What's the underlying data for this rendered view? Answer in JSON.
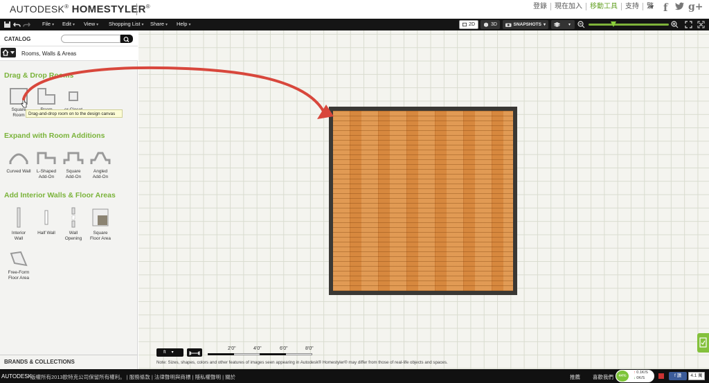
{
  "brand": {
    "prefix": "AUTODESK",
    "mark": "®",
    "name": "HOMESTYLER",
    "tm": "®"
  },
  "top_links": [
    "登錄",
    "現在加入",
    "移動工具",
    "支持",
    "繁"
  ],
  "toolbar": {
    "menus": [
      "File",
      "Edit",
      "View",
      "Shopping List",
      "Share",
      "Help"
    ],
    "view_2d": "2D",
    "view_3d": "3D",
    "snapshots": "SNAPSHOTS"
  },
  "panel": {
    "catalog_label": "CATALOG",
    "search_placeholder": "",
    "breadcrumb": "Rooms, Walls & Areas",
    "help_glyph": "?",
    "sections": [
      {
        "title": "Drag & Drop Rooms"
      },
      {
        "title": "Expand with Room Additions"
      },
      {
        "title": "Add Interior Walls & Floor Areas"
      }
    ],
    "drag_items": [
      {
        "label_1": "Square",
        "label_2": "Room"
      },
      {
        "label_1": "",
        "label_2": "Room"
      },
      {
        "label_1": "",
        "label_2": "or Closet"
      }
    ],
    "tooltip": "Drag-and-drop room on to the design canvas",
    "additions": [
      {
        "label_1": "Curved Wall",
        "label_2": ""
      },
      {
        "label_1": "L-Shaped",
        "label_2": "Add-On"
      },
      {
        "label_1": "Square",
        "label_2": "Add-On"
      },
      {
        "label_1": "Angled",
        "label_2": "Add-On"
      }
    ],
    "walls": [
      {
        "label_1": "Interior",
        "label_2": "Wall"
      },
      {
        "label_1": "Half Wall",
        "label_2": ""
      },
      {
        "label_1": "Wall",
        "label_2": "Opening"
      },
      {
        "label_1": "Square",
        "label_2": "Floor Area"
      },
      {
        "label_1": "Free-Form",
        "label_2": "Floor Area"
      }
    ],
    "brands_label": "BRANDS & COLLECTIONS"
  },
  "canvas": {
    "units": "ft",
    "scale_labels": [
      "2'0\"",
      "4'0\"",
      "6'0\"",
      "8'0\""
    ],
    "note": "Note: Sizes, shapes, colors and other features of images seen appearing in Autodesk® Homestyler® may differ from those of real-life objects and spaces."
  },
  "status": {
    "autodesk": "AUTODESK",
    "links": "版權所有2013歐特克公司保留所有權利。 | 服務條款 | 法律聲明與商標 | 隱私權聲明 | 關於",
    "right_1": "推薦",
    "right_2": "喜歡我們",
    "speed_pct": "44%",
    "speed_up": "0.1K/S",
    "speed_down": "0K/S",
    "fb_like": "讚",
    "fb_count": "4.1 萬"
  },
  "colors": {
    "accent_green": "#7ab33a",
    "arrow_red": "#d8473c",
    "floor_wood": "#d7883e"
  }
}
